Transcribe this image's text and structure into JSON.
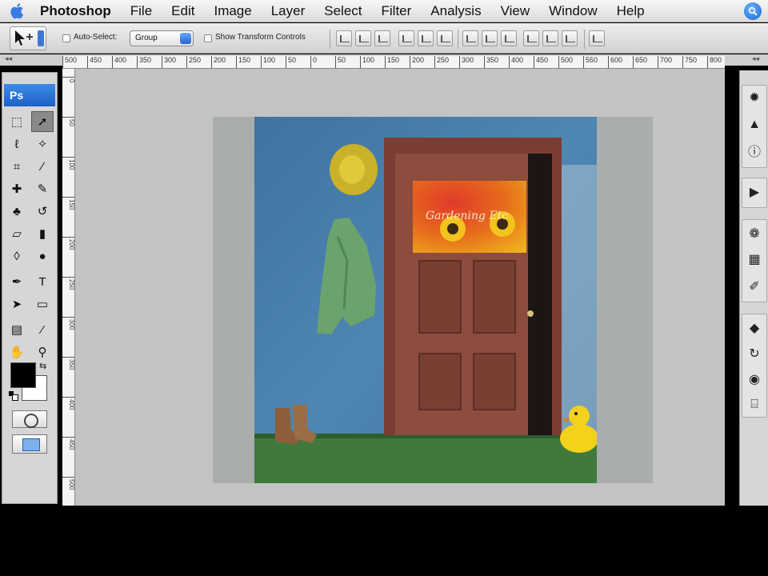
{
  "menubar": {
    "items": [
      "Photoshop",
      "File",
      "Edit",
      "Image",
      "Layer",
      "Select",
      "Filter",
      "Analysis",
      "View",
      "Window",
      "Help"
    ]
  },
  "options": {
    "auto_select_label": "Auto-Select:",
    "group_value": "Group",
    "show_transform_label": "Show Transform Controls"
  },
  "toolbox": {
    "logo": "Ps",
    "tools": [
      {
        "name": "marquee-tool",
        "glyph": "⬚"
      },
      {
        "name": "move-tool",
        "glyph": "➚"
      },
      {
        "name": "lasso-tool",
        "glyph": "ℓ"
      },
      {
        "name": "magic-wand-tool",
        "glyph": "✧"
      },
      {
        "name": "crop-tool",
        "glyph": "⌗"
      },
      {
        "name": "slice-tool",
        "glyph": "∕"
      },
      {
        "name": "healing-brush-tool",
        "glyph": "✚"
      },
      {
        "name": "brush-tool",
        "glyph": "✎"
      },
      {
        "name": "clone-stamp-tool",
        "glyph": "♣"
      },
      {
        "name": "history-brush-tool",
        "glyph": "↺"
      },
      {
        "name": "eraser-tool",
        "glyph": "▱"
      },
      {
        "name": "gradient-tool",
        "glyph": "▮"
      },
      {
        "name": "blur-tool",
        "glyph": "◊"
      },
      {
        "name": "dodge-tool",
        "glyph": "●"
      },
      {
        "name": "pen-tool",
        "glyph": "✒"
      },
      {
        "name": "type-tool",
        "glyph": "T"
      },
      {
        "name": "path-select-tool",
        "glyph": "➤"
      },
      {
        "name": "shape-tool",
        "glyph": "▭"
      },
      {
        "name": "notes-tool",
        "glyph": "▤"
      },
      {
        "name": "eyedropper-tool",
        "glyph": "⁄"
      },
      {
        "name": "hand-tool",
        "glyph": "✋"
      },
      {
        "name": "zoom-tool",
        "glyph": "⚲"
      }
    ]
  },
  "ruler_top": [
    "500",
    "450",
    "400",
    "350",
    "300",
    "250",
    "200",
    "150",
    "100",
    "50",
    "0",
    "50",
    "100",
    "150",
    "200",
    "250",
    "300",
    "350",
    "400",
    "450",
    "500",
    "550",
    "600",
    "650",
    "700",
    "750",
    "800"
  ],
  "ruler_left": [
    "0",
    "50",
    "100",
    "150",
    "200",
    "250",
    "300",
    "350",
    "400",
    "450",
    "500"
  ],
  "photo": {
    "sign_text": "Gardening Etc"
  },
  "rightdock": {
    "icons": [
      "navigator-icon",
      "histogram-icon",
      "info-icon",
      "actions-icon",
      "styles-icon",
      "swatches-icon",
      "brushes-icon",
      "layers-icon",
      "channels-icon",
      "paths-icon",
      "transform-icon"
    ]
  },
  "colors": {
    "wall": "#4a7ea8",
    "door": "#8a4a3c",
    "floor": "#3f7a3c",
    "accent": "#2466d0"
  }
}
